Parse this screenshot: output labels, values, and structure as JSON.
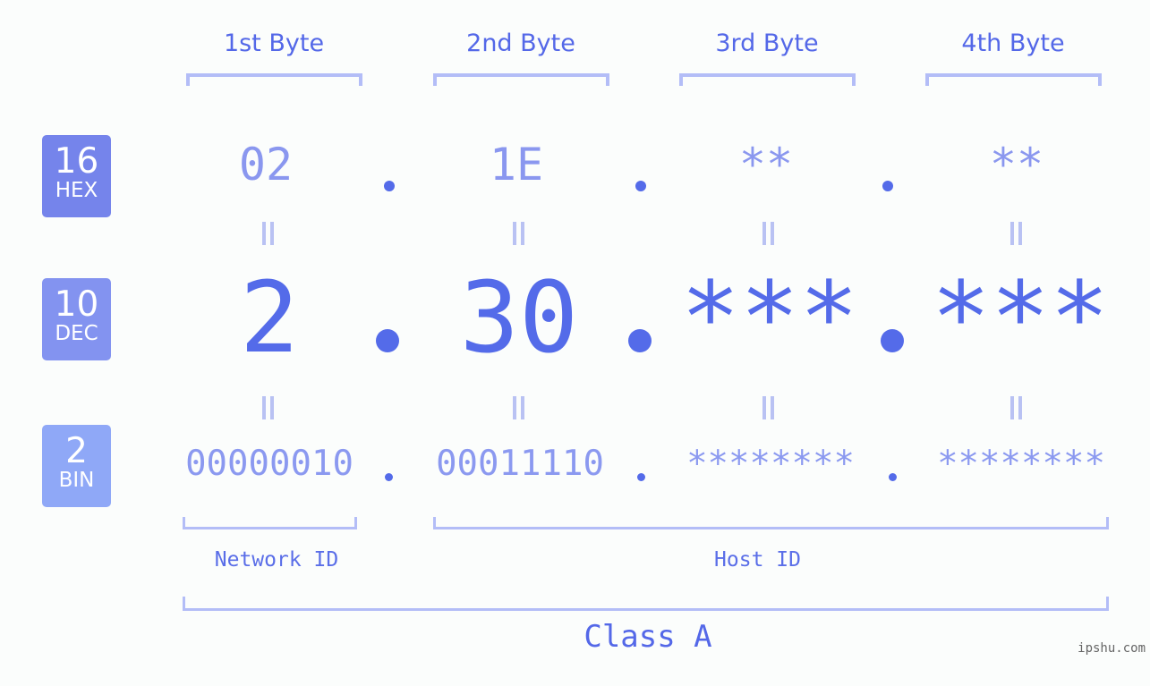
{
  "byte_headers": [
    "1st Byte",
    "2nd Byte",
    "3rd Byte",
    "4th Byte"
  ],
  "badges": {
    "hex": {
      "num": "16",
      "label": "HEX",
      "color": "#7584eb"
    },
    "dec": {
      "num": "10",
      "label": "DEC",
      "color": "#8393f0"
    },
    "bin": {
      "num": "2",
      "label": "BIN",
      "color": "#8fa8f7"
    }
  },
  "hex": [
    "02",
    "1E",
    "**",
    "**"
  ],
  "dec": [
    "2",
    "30",
    "***",
    "***"
  ],
  "bin": [
    "00000010",
    "00011110",
    "********",
    "********"
  ],
  "labels": {
    "network": "Network ID",
    "host": "Host ID",
    "class": "Class A"
  },
  "watermark": "ipshu.com",
  "colors": {
    "accent": "#546be9",
    "bracket": "#b3bdf7",
    "background": "#fbfdfc"
  }
}
